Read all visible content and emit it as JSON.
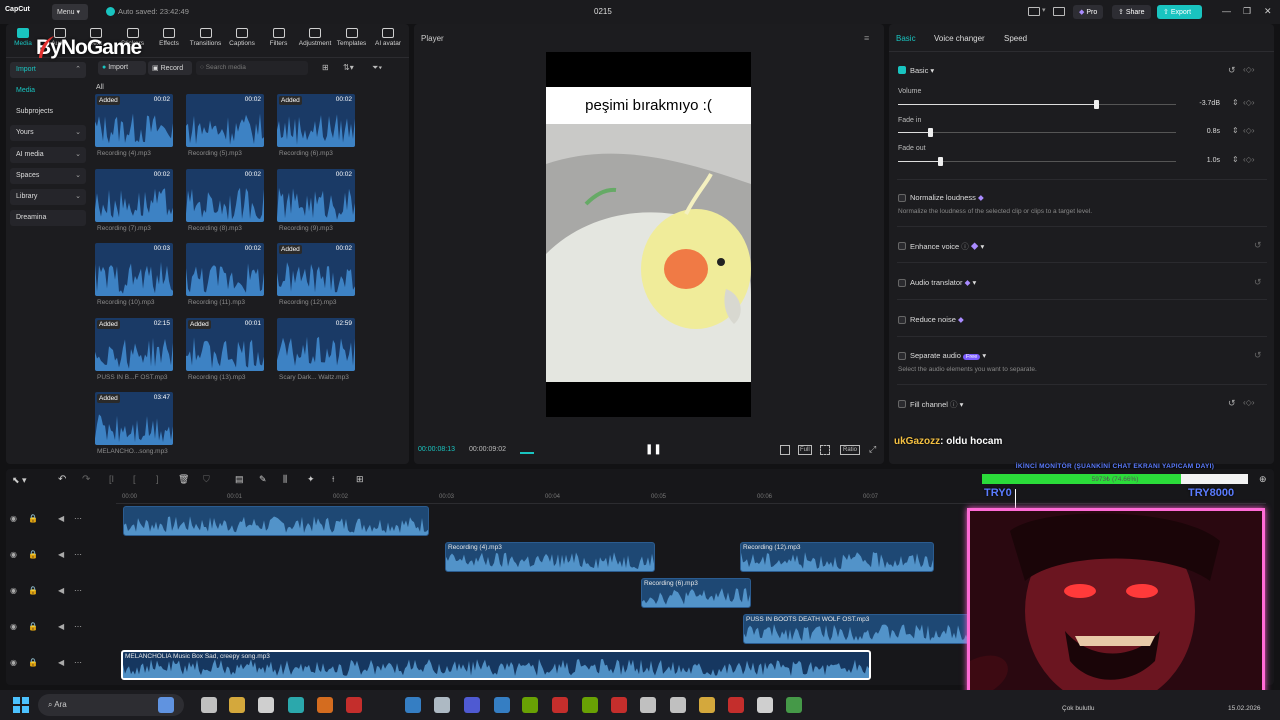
{
  "app": {
    "logo": "CapCut",
    "menu_label": "Menu",
    "autosave": "Auto saved: 23:42:49",
    "project_title": "0215"
  },
  "topbar": {
    "pro_label": "Pro",
    "share_label": "Share",
    "export_label": "Export"
  },
  "watermark": "ByNoGame",
  "toolbar_tabs": [
    {
      "label": "Media",
      "icon": "media-icon"
    },
    {
      "label": "Audio",
      "icon": "audio-icon"
    },
    {
      "label": "Text",
      "icon": "text-icon"
    },
    {
      "label": "Stickers",
      "icon": "stickers-icon"
    },
    {
      "label": "Effects",
      "icon": "effects-icon"
    },
    {
      "label": "Transitions",
      "icon": "transitions-icon"
    },
    {
      "label": "Captions",
      "icon": "captions-icon"
    },
    {
      "label": "Filters",
      "icon": "filters-icon"
    },
    {
      "label": "Adjustment",
      "icon": "adjustment-icon"
    },
    {
      "label": "Templates",
      "icon": "templates-icon"
    },
    {
      "label": "AI avatar",
      "icon": "ai-avatar-icon"
    }
  ],
  "sidebar": {
    "items": [
      {
        "label": "Import",
        "active": true
      },
      {
        "label": "Media"
      },
      {
        "label": "Subprojects"
      },
      {
        "label": "Yours"
      },
      {
        "label": "AI media"
      },
      {
        "label": "Spaces"
      },
      {
        "label": "Library"
      },
      {
        "label": "Dreamina"
      }
    ]
  },
  "media_toolbar": {
    "import_label": "Import",
    "record_label": "Record",
    "search_placeholder": "Search media",
    "filter_label": "All"
  },
  "media_items": [
    {
      "name": "Recording (4).mp3",
      "duration": "00:02",
      "added": true
    },
    {
      "name": "Recording (5).mp3",
      "duration": "00:02",
      "added": false
    },
    {
      "name": "Recording (6).mp3",
      "duration": "00:02",
      "added": true
    },
    {
      "name": "Recording (7).mp3",
      "duration": "00:02",
      "added": false
    },
    {
      "name": "Recording (8).mp3",
      "duration": "00:02",
      "added": false
    },
    {
      "name": "Recording (9).mp3",
      "duration": "00:02",
      "added": false
    },
    {
      "name": "Recording (10).mp3",
      "duration": "00:03",
      "added": false
    },
    {
      "name": "Recording (11).mp3",
      "duration": "00:02",
      "added": false
    },
    {
      "name": "Recording (12).mp3",
      "duration": "00:02",
      "added": true
    },
    {
      "name": "PUSS IN B...F OST.mp3",
      "duration": "02:15",
      "added": true
    },
    {
      "name": "Recording (13).mp3",
      "duration": "00:01",
      "added": true
    },
    {
      "name": "Scary Dark... Waltz.mp3",
      "duration": "02:59",
      "added": false
    },
    {
      "name": "MELANCHO...song.mp3",
      "duration": "03:47",
      "added": true
    }
  ],
  "added_label": "Added",
  "player": {
    "title": "Player",
    "caption": "peşimi bırakmıyo :(",
    "time_current": "00:00:08:13",
    "time_total": "00:00:09:02",
    "ratio_label": "Ratio"
  },
  "right_panel": {
    "tabs": [
      "Basic",
      "Voice changer",
      "Speed"
    ],
    "basic_label": "Basic",
    "volume": {
      "label": "Volume",
      "value": "-3.7dB"
    },
    "fade_in": {
      "label": "Fade in",
      "value": "0.8s"
    },
    "fade_out": {
      "label": "Fade out",
      "value": "1.0s"
    },
    "normalize": {
      "label": "Normalize loudness",
      "desc": "Normalize the loudness of the selected clip or clips to a target level."
    },
    "enhance_voice": "Enhance voice",
    "audio_translator": "Audio translator",
    "reduce_noise": "Reduce noise",
    "separate_audio": {
      "label": "Separate audio",
      "badge": "Free",
      "desc": "Select the audio elements you want to separate."
    },
    "fill_channel": "Fill channel"
  },
  "chat": {
    "user": "ukGazozz",
    "message": ": oldu hocam"
  },
  "timeline": {
    "ruler": [
      "00:00",
      "00:01",
      "00:02",
      "00:03",
      "00:04",
      "00:05",
      "00:06",
      "00:07"
    ],
    "clips": [
      {
        "name": "",
        "track": 0
      },
      {
        "name": "Recording (4).mp3",
        "track": 1
      },
      {
        "name": "Recording (12).mp3",
        "track": 1
      },
      {
        "name": "Recording (6).mp3",
        "track": 2
      },
      {
        "name": "PUSS IN BOOTS  DEATH WOLF OST.mp3",
        "track": 3
      },
      {
        "name": "MELANCHOLIA Music Box Sad, creepy song.mp3",
        "track": 4
      }
    ]
  },
  "stream": {
    "goal_title": "İKİNCİ MONİTÖR (ŞUANKİNİ CHAT EKRANI YAPICAM DAYI)",
    "goal_progress": "5973₺ (74.66%)",
    "goal_fraction": 0.7466,
    "goal_left": "TRY0",
    "goal_right": "TRY8000"
  },
  "taskbar": {
    "search_placeholder": "Ara",
    "notification": "Çok bulutlu",
    "date": "15.02.2026"
  }
}
